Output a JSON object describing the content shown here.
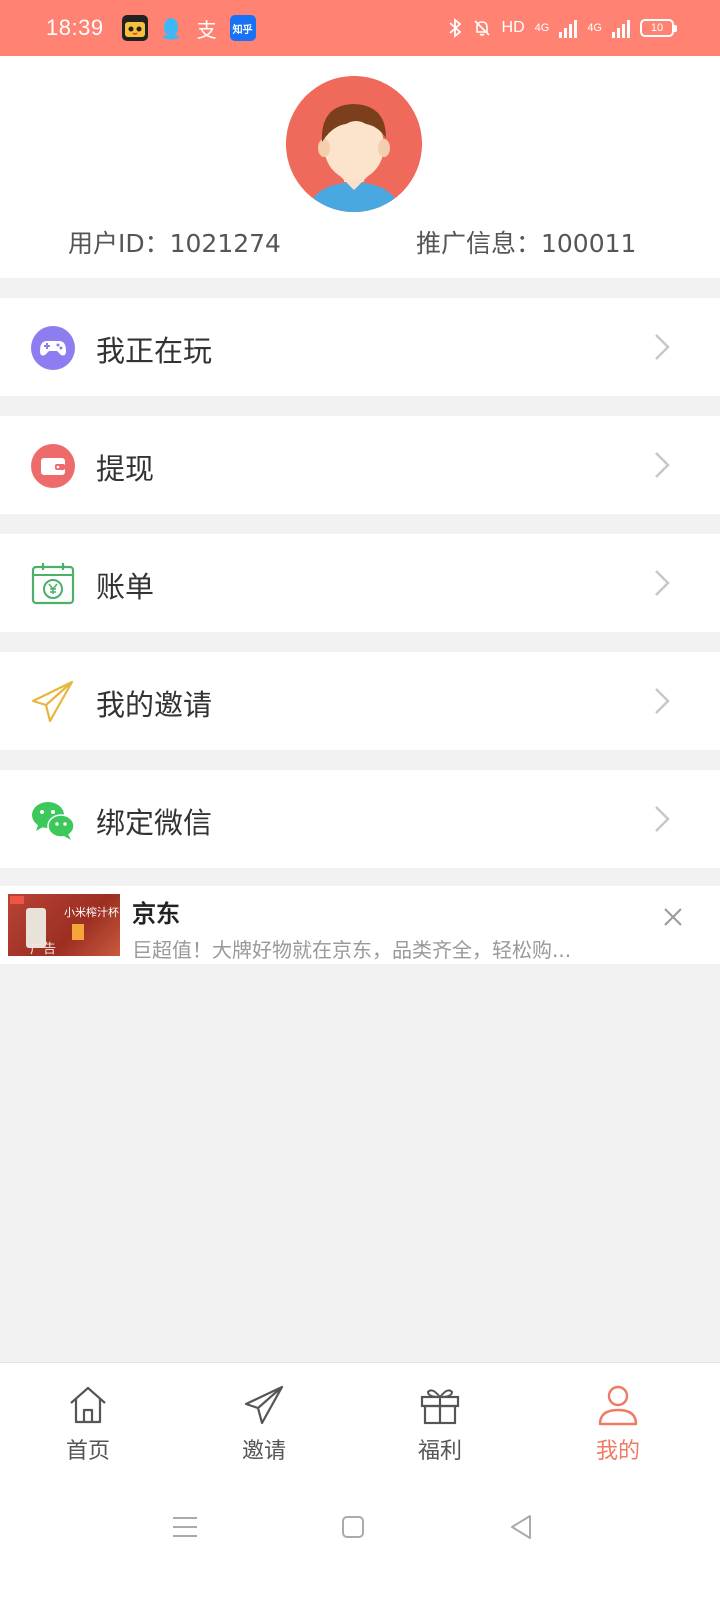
{
  "status_bar": {
    "time": "18:39",
    "notification_icons": [
      "cartoon-cat-app-icon",
      "qq-icon",
      "alipay-icon",
      "zhihu-icon"
    ],
    "zhi_glyph": "支",
    "zhihu_label": "知乎",
    "hd_label": "HD",
    "network_1": "4G",
    "network_2": "4G",
    "battery": "10"
  },
  "profile": {
    "user_id": "用户ID：1021274",
    "promo_info": "推广信息：100011"
  },
  "menu": [
    {
      "label": "我正在玩",
      "icon": "gamepad-icon",
      "color": "#8c7ef0"
    },
    {
      "label": "提现",
      "icon": "wallet-icon",
      "color": "#ee6b6b"
    },
    {
      "label": "账单",
      "icon": "bill-calendar-icon",
      "color": "#4caf6a"
    },
    {
      "label": "我的邀请",
      "icon": "paper-plane-icon",
      "color": "#e8b63e"
    },
    {
      "label": "绑定微信",
      "icon": "wechat-icon",
      "color": "#3cc85b"
    }
  ],
  "ad": {
    "title": "京东",
    "description": "巨超值！大牌好物就在京东，品类齐全，轻松购...",
    "thumb_brand": "小米榨汁杯",
    "thumb_tag": "广告"
  },
  "tabs": [
    {
      "label": "首页",
      "icon": "home-icon",
      "active": false
    },
    {
      "label": "邀请",
      "icon": "paper-plane-icon",
      "active": false
    },
    {
      "label": "福利",
      "icon": "gift-icon",
      "active": false
    },
    {
      "label": "我的",
      "icon": "user-icon",
      "active": true
    }
  ],
  "colors": {
    "accent": "#ff8272",
    "active_tab": "#f07a64",
    "background": "#f2f2f2"
  }
}
